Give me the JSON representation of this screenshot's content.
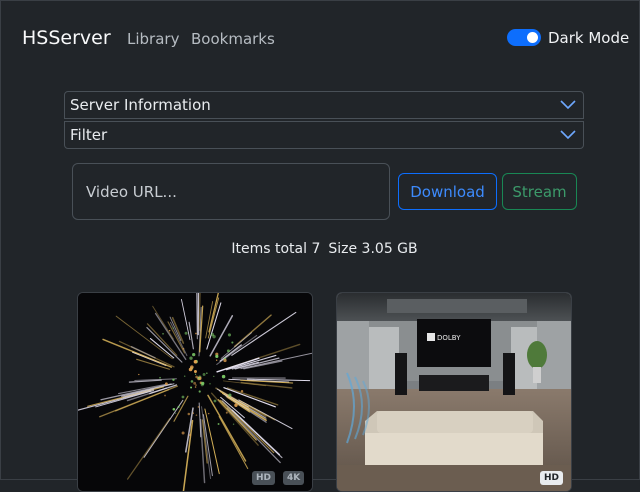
{
  "navbar": {
    "brand": "HSServer",
    "links": [
      "Library",
      "Bookmarks"
    ],
    "dark_mode_label": "Dark Mode",
    "dark_mode_on": true
  },
  "accordion": {
    "server_info": "Server Information",
    "filter": "Filter"
  },
  "download_form": {
    "url_placeholder": "Video URL...",
    "download_label": "Download",
    "stream_label": "Stream"
  },
  "summary": {
    "items_text": "Items total 7",
    "size_text": "Size 3.05 GB"
  },
  "videos": [
    {
      "badges": [
        "HD",
        "4K"
      ]
    },
    {
      "badges": [
        "HD"
      ],
      "logo_text": "DOLBY"
    }
  ],
  "colors": {
    "background": "#212529",
    "primary": "#0d6efd",
    "success": "#198754"
  }
}
